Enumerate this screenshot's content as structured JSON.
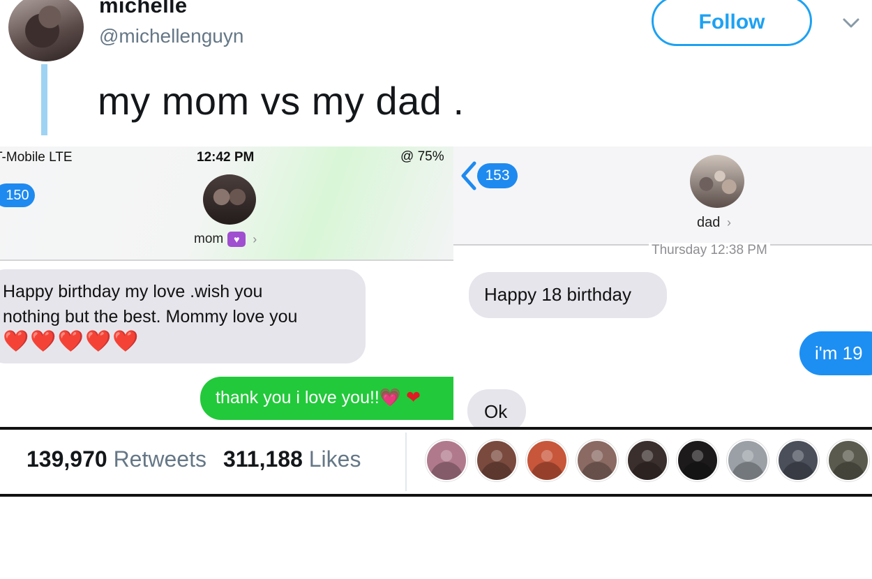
{
  "tweet": {
    "display_name": "michelle",
    "handle": "@michellenguyn",
    "follow_label": "Follow",
    "text": "my mom vs my dad ."
  },
  "mom_chat": {
    "carrier": "T-Mobile  LTE",
    "time": "12:42 PM",
    "battery": "@ 75%",
    "back_badge": "150",
    "contact_name": "mom",
    "contact_badge_icon": "purple-heart-icon",
    "message_line1": "Happy birthday my love .wish you",
    "message_line2": "nothing but the best. Mommy love you",
    "hearts": "❤️❤️❤️❤️❤️",
    "reply": "thank you i love you!!",
    "reply_emoji_1": "💗",
    "reply_emoji_2": "❤"
  },
  "dad_chat": {
    "back_badge": "153",
    "contact_name": "dad",
    "timestamp": "Thursday 12:38 PM",
    "message1": "Happy 18 birthday",
    "reply": "i'm 19",
    "message2": "Ok"
  },
  "stats": {
    "retweets_count": "139,970",
    "retweets_label": "Retweets",
    "likes_count": "311,188",
    "likes_label": "Likes",
    "liker_colors": [
      "#b07a8c",
      "#7a4a3e",
      "#c8563a",
      "#8a6a62",
      "#3a2f2c",
      "#1c1a1a",
      "#9aa0a6",
      "#4a4f5a",
      "#5a5a4e"
    ]
  },
  "colors": {
    "twitter_blue": "#1da1f2",
    "imessage_blue": "#1d8ff3",
    "sms_green": "#22c93a",
    "bubble_gray": "#e6e5eb"
  }
}
